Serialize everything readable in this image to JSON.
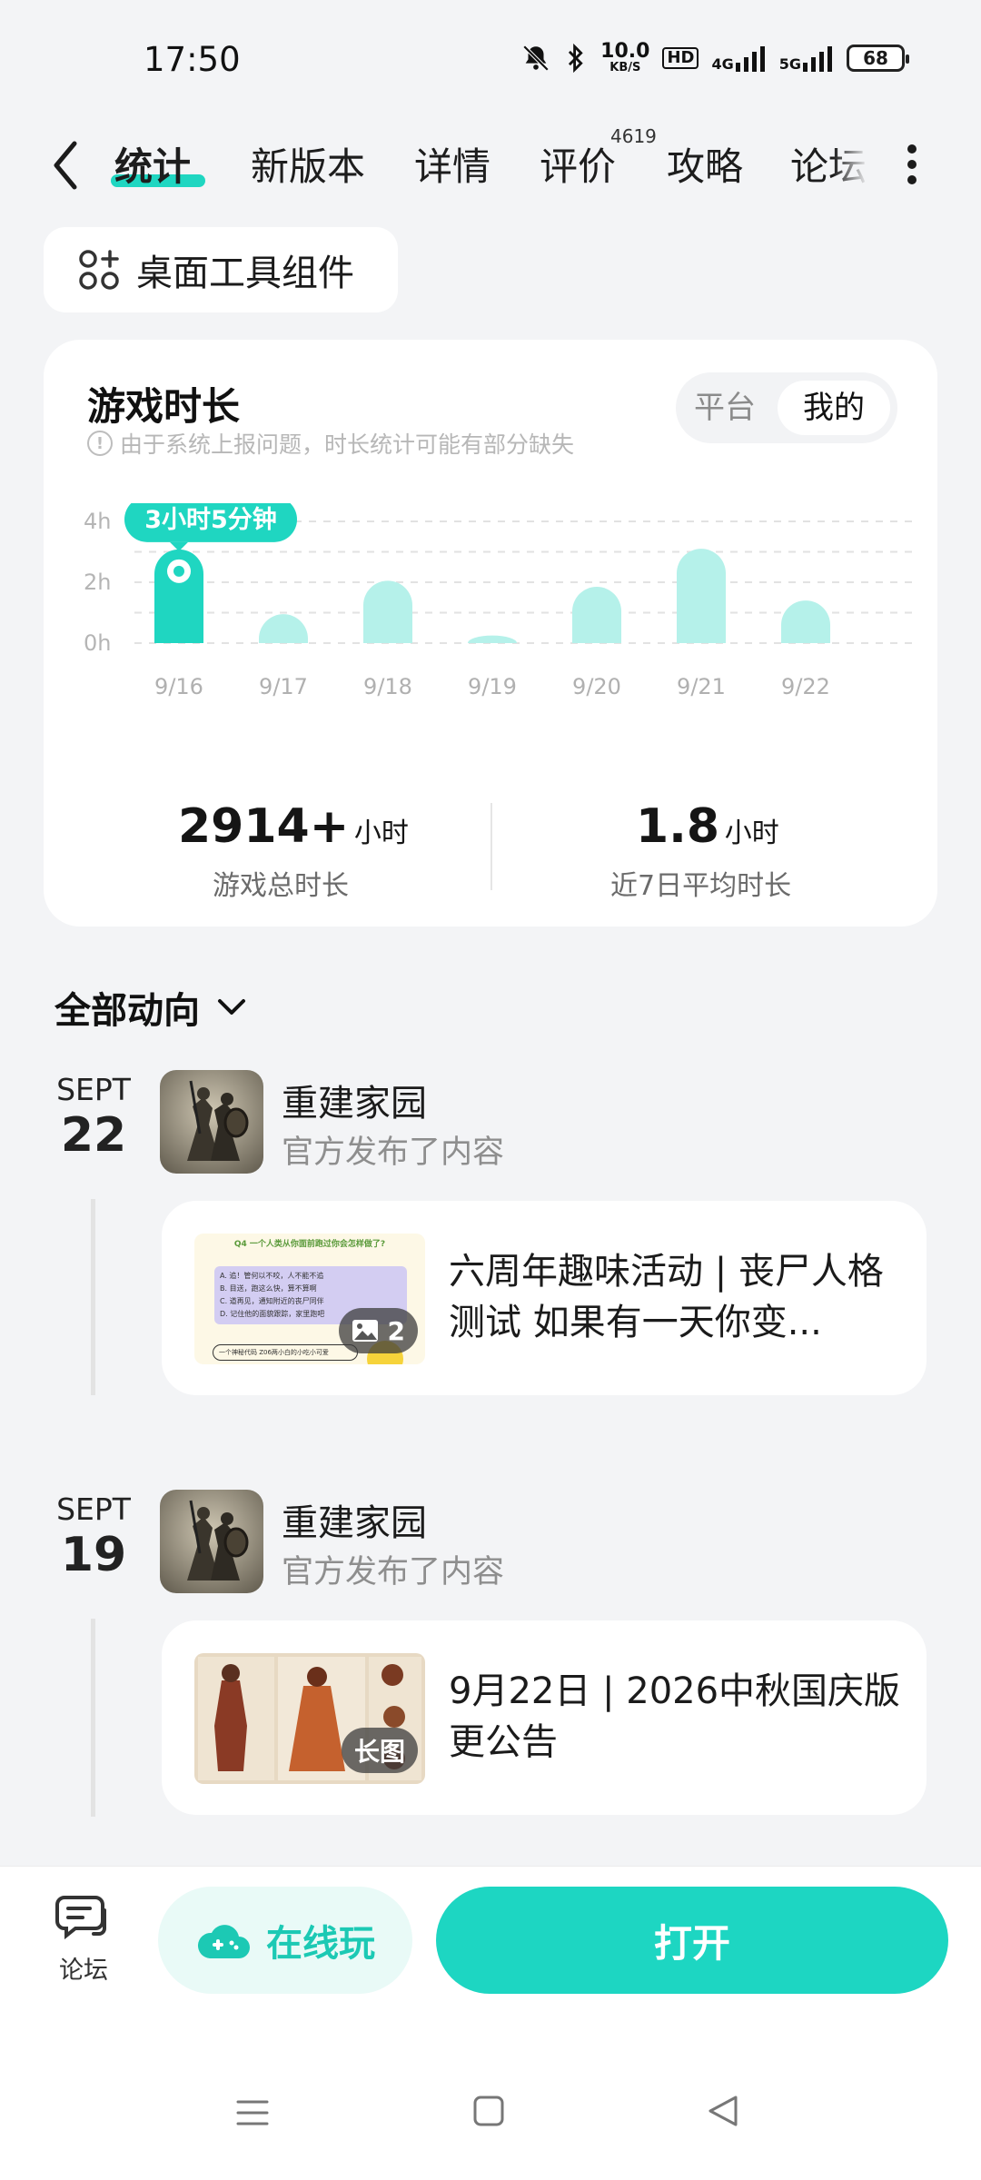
{
  "status_bar": {
    "time": "17:50",
    "net_speed_value": "10.0",
    "net_speed_unit": "KB/S",
    "hd_label": "HD",
    "network_4g": "4G",
    "network_5g": "5G",
    "battery": "68"
  },
  "tabs": [
    {
      "label": "统计",
      "active": true
    },
    {
      "label": "新版本"
    },
    {
      "label": "详情"
    },
    {
      "label": "评价",
      "badge": "4619"
    },
    {
      "label": "攻略"
    },
    {
      "label": "论坛"
    }
  ],
  "widget_button": {
    "label": "桌面工具组件",
    "icon": "widgets-icon"
  },
  "stats_card": {
    "title": "游戏时长",
    "note": "由于系统上报问题，时长统计可能有部分缺失",
    "toggle": {
      "platform": "平台",
      "mine": "我的",
      "selected": "mine"
    },
    "total": {
      "value": "2914+",
      "unit": "小时",
      "label": "游戏总时长"
    },
    "average": {
      "value": "1.8",
      "unit": "小时",
      "label": "近7日平均时长"
    }
  },
  "chart_data": {
    "type": "bar",
    "categories": [
      "9/16",
      "9/17",
      "9/18",
      "9/19",
      "9/20",
      "9/21",
      "9/22"
    ],
    "values": [
      3.08,
      0.95,
      2.05,
      0.25,
      1.85,
      3.1,
      1.4
    ],
    "ylim": [
      0,
      4
    ],
    "y_ticks": [
      "0h",
      "2h",
      "4h"
    ],
    "highlight_index": 0,
    "tooltip": "3小时5分钟",
    "grid": true,
    "colors": {
      "highlight": "#1fd6c1",
      "normal": "#b5f1ea",
      "grid": "#e2e2e2"
    }
  },
  "activity": {
    "title": "全部动向",
    "entries": [
      {
        "month": "SEPT",
        "day": "22",
        "game": "重建家园",
        "subtitle": "官方发布了内容",
        "post_text": "六周年趣味活动 | 丧尸人格测试 如果有一天你变...",
        "thumb_badge": "2",
        "thumb_badge_icon": "image-icon",
        "thumb_caption": "Q4 一个人类从你面前跑过你会怎样做了?",
        "thumb_options": [
          "A. 追！管何以不咬，人不能不追",
          "B. 目送，跑这么快，算不算啊",
          "C. 道再见，通知附近的丧尸同伴",
          "D. 记住他的面貌跟踪，家里跑吧"
        ],
        "thumb_footer": "一个神秘代码    Z06两小白的小吃小可爱"
      },
      {
        "month": "SEPT",
        "day": "19",
        "game": "重建家园",
        "subtitle": "官方发布了内容",
        "post_text": "9月22日 | 2026中秋国庆版更公告",
        "thumb_badge": "长图"
      }
    ]
  },
  "bottom_bar": {
    "forum_label": "论坛",
    "play_online_label": "在线玩",
    "open_label": "打开"
  }
}
